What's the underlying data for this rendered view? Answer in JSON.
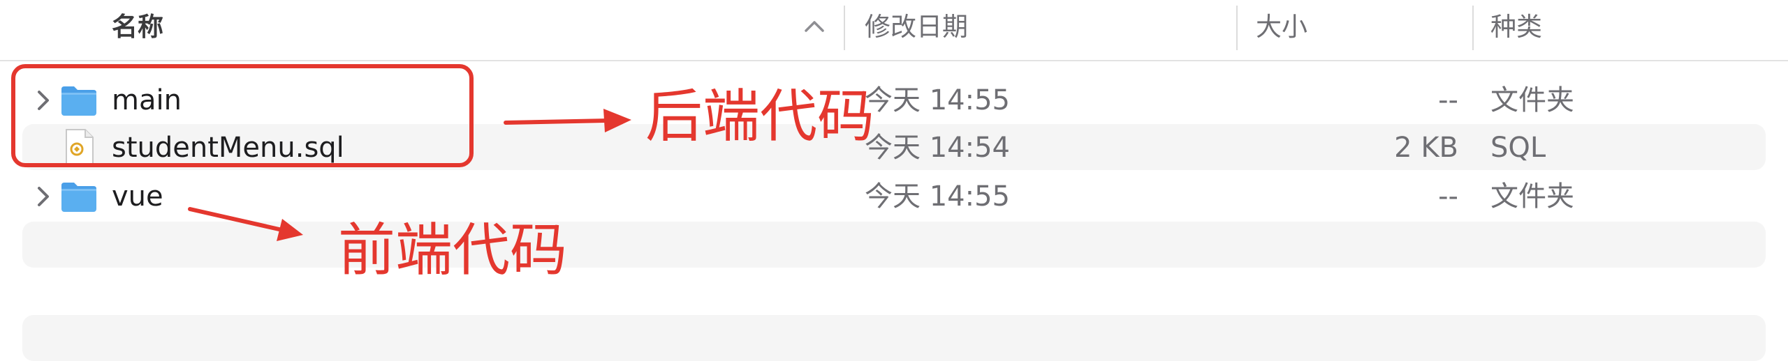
{
  "columns": {
    "name": "名称",
    "date_modified": "修改日期",
    "size": "大小",
    "kind": "种类"
  },
  "sort": {
    "column": "name",
    "direction": "ascending"
  },
  "rows": [
    {
      "icon": "folder-icon",
      "name": "main",
      "date": "今天 14:55",
      "size": "--",
      "kind": "文件夹",
      "expandable": true
    },
    {
      "icon": "sql-file-icon",
      "name": "studentMenu.sql",
      "date": "今天 14:54",
      "size": "2 KB",
      "kind": "SQL",
      "expandable": false
    },
    {
      "icon": "folder-icon",
      "name": "vue",
      "date": "今天 14:55",
      "size": "--",
      "kind": "文件夹",
      "expandable": true
    }
  ],
  "annotations": {
    "backend_label": "后端代码",
    "frontend_label": "前端代码",
    "color": "#e4372e"
  },
  "colors": {
    "folder_blue": "#5aaff0",
    "stripe": "#f5f5f5",
    "secondary_text": "#6e6e73"
  }
}
